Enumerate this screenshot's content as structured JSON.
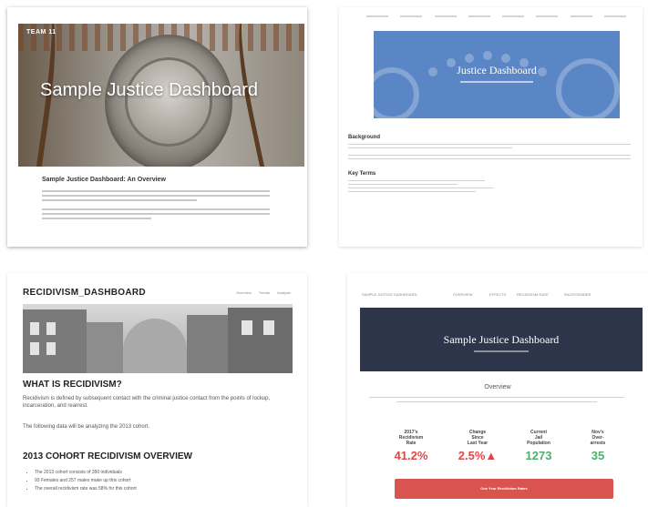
{
  "card1": {
    "team_label": "TEAM 11",
    "hero_title": "Sample Justice Dashboard",
    "overview_heading": "Sample Justice Dashboard: An Overview"
  },
  "card2": {
    "banner_title": "Justice Dashboard",
    "background_heading": "Background",
    "key_terms_heading": "Key Terms"
  },
  "card3": {
    "brand": "RECIDIVISM_DASHBOARD",
    "tabs": [
      "Overview",
      "Trends",
      "Analysis"
    ],
    "question_heading": "WHAT IS RECIDIVISM?",
    "definition_text": "Recidivism is defined by subsequent contact with the criminal justice contact from the points of lockup, incarceration, and rearrest.",
    "analysis_text": "The following data will be analyzing the 2013 cohort.",
    "cohort_heading": "2013 COHORT RECIDIVISM OVERVIEW",
    "bullets": [
      "The 2013 cohort consists of 350 individuals",
      "93 Females and 257 males make up this cohort",
      "The overall recidivism rate was 58% for this cohort"
    ]
  },
  "card4": {
    "nav": [
      "SAMPLE JUSTICE DASHBOARD",
      "OVERVIEW",
      "EFFECTS",
      "RECIDIVISM RATE",
      "RACE/GENDER"
    ],
    "banner_title": "Sample Justice Dashboard",
    "overview_heading": "Overview",
    "stats": [
      {
        "label_line1": "2017's",
        "label_line2": "Recidivism",
        "label_line3": "Rate",
        "value": "41.2%",
        "color": "#e0464a"
      },
      {
        "label_line1": "Change",
        "label_line2": "Since",
        "label_line3": "Last Year",
        "value": "2.5%▲",
        "color": "#e0464a"
      },
      {
        "label_line1": "Current",
        "label_line2": "Jail",
        "label_line3": "Population",
        "value": "1273",
        "color": "#4caf6a"
      },
      {
        "label_line1": "Nov's",
        "label_line2": "Over-",
        "label_line3": "arrests",
        "value": "35",
        "color": "#4caf6a"
      }
    ],
    "cta_label": "One Year Recidivism Rates"
  },
  "colors": {
    "banner_blue": "#5b86c6",
    "navy": "#2c3549",
    "alert_red": "#d9534f",
    "good_green": "#4caf6a"
  }
}
